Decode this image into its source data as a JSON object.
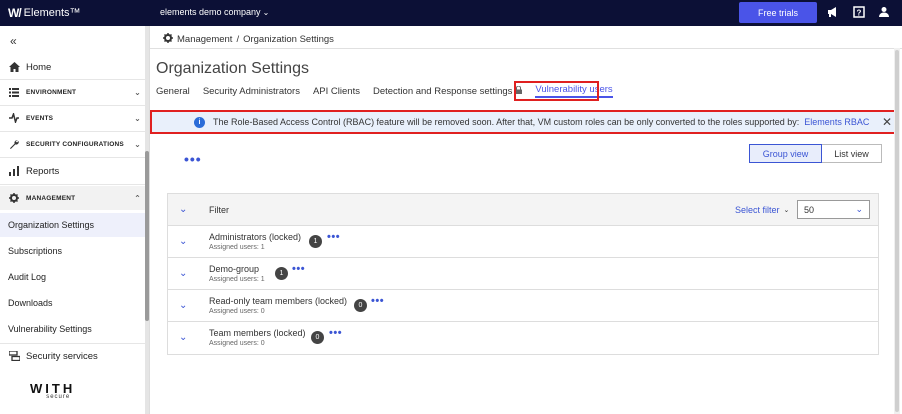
{
  "topbar": {
    "logo_text": "Elements™",
    "company": "elements demo company",
    "free_trials": "Free trials"
  },
  "sidebar": {
    "home": "Home",
    "environment": "ENVIRONMENT",
    "events": "EVENTS",
    "security_configurations": "SECURITY CONFIGURATIONS",
    "reports": "Reports",
    "management": "MANAGEMENT",
    "items": [
      "Organization Settings",
      "Subscriptions",
      "Audit Log",
      "Downloads",
      "Vulnerability Settings"
    ],
    "security_services": "Security services",
    "brand_top": "WITH",
    "brand_bottom": "secure"
  },
  "breadcrumb": {
    "root": "Management",
    "current": "Organization Settings"
  },
  "page_title": "Organization Settings",
  "tabs": [
    "General",
    "Security Administrators",
    "API Clients",
    "Detection and Response settings",
    "Vulnerability users"
  ],
  "banner": {
    "text": "The Role-Based Access Control (RBAC) feature will be removed soon. After that, VM custom roles can be only converted to the roles supported by:",
    "link": "Elements RBAC"
  },
  "view": {
    "group": "Group view",
    "list": "List view"
  },
  "table": {
    "filter_label": "Filter",
    "select_filter": "Select filter",
    "page_size": "50",
    "groups": [
      {
        "name": "Administrators (locked)",
        "sub": "Assigned users: 1",
        "count": "1"
      },
      {
        "name": "Demo-group",
        "sub": "Assigned users: 1",
        "count": "1"
      },
      {
        "name": "Read-only team members (locked)",
        "sub": "Assigned users: 0",
        "count": "0"
      },
      {
        "name": "Team members (locked)",
        "sub": "Assigned users: 0",
        "count": "0"
      }
    ]
  },
  "colors": {
    "topbar": "#0c1036",
    "accent": "#4a54e8",
    "highlight": "#e02020"
  }
}
